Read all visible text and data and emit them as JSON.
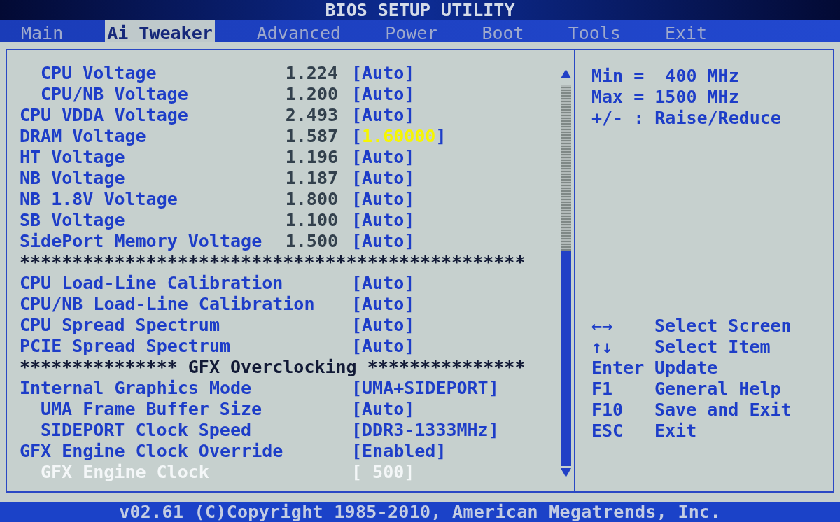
{
  "window": {
    "title": "BIOS SETUP UTILITY"
  },
  "tabs": [
    {
      "label": "Main",
      "selected": false
    },
    {
      "label": "Ai Tweaker",
      "selected": true
    },
    {
      "label": "Advanced",
      "selected": false
    },
    {
      "label": "Power",
      "selected": false
    },
    {
      "label": "Boot",
      "selected": false
    },
    {
      "label": "Tools",
      "selected": false
    },
    {
      "label": "Exit",
      "selected": false
    }
  ],
  "settings": [
    {
      "kind": "group",
      "children": [
        {
          "kind": "option",
          "label": "CPU Voltage",
          "reading": "1.224",
          "setting": "[Auto]",
          "selected": false,
          "modified": false
        },
        {
          "kind": "option",
          "label": "CPU/NB Voltage",
          "reading": "1.200",
          "setting": "[Auto]",
          "selected": false,
          "modified": false
        }
      ]
    },
    {
      "kind": "option",
      "label": "CPU VDDA Voltage",
      "reading": "2.493",
      "setting": "[Auto]",
      "selected": false,
      "modified": false
    },
    {
      "kind": "option",
      "label": "DRAM Voltage",
      "reading": "1.587",
      "setting": "[1.60000]",
      "selected": false,
      "modified": true
    },
    {
      "kind": "option",
      "label": "HT Voltage",
      "reading": "1.196",
      "setting": "[Auto]",
      "selected": false,
      "modified": false
    },
    {
      "kind": "option",
      "label": "NB Voltage",
      "reading": "1.187",
      "setting": "[Auto]",
      "selected": false,
      "modified": false
    },
    {
      "kind": "option",
      "label": "NB 1.8V Voltage",
      "reading": "1.800",
      "setting": "[Auto]",
      "selected": false,
      "modified": false
    },
    {
      "kind": "option",
      "label": "SB Voltage",
      "reading": "1.100",
      "setting": "[Auto]",
      "selected": false,
      "modified": false
    },
    {
      "kind": "option",
      "label": "SidePort Memory Voltage",
      "reading": "1.500",
      "setting": "[Auto]",
      "selected": false,
      "modified": false
    },
    {
      "kind": "separator",
      "text": "************************************************"
    },
    {
      "kind": "option",
      "label": "CPU Load-Line Calibration",
      "setting": "[Auto]",
      "selected": false,
      "modified": false
    },
    {
      "kind": "option",
      "label": "CPU/NB Load-Line Calibration",
      "setting": "[Auto]",
      "selected": false,
      "modified": false
    },
    {
      "kind": "option",
      "label": "CPU Spread Spectrum",
      "setting": "[Auto]",
      "selected": false,
      "modified": false
    },
    {
      "kind": "option",
      "label": "PCIE Spread Spectrum",
      "setting": "[Auto]",
      "selected": false,
      "modified": false
    },
    {
      "kind": "separator",
      "text": "*************** GFX Overclocking ***************"
    },
    {
      "kind": "option",
      "label": "Internal Graphics Mode",
      "setting": "[UMA+SIDEPORT]",
      "selected": false,
      "modified": false,
      "children": [
        {
          "kind": "option",
          "label": "UMA Frame Buffer Size",
          "setting": "[Auto]",
          "selected": false,
          "modified": false
        },
        {
          "kind": "option",
          "label": "SIDEPORT Clock Speed",
          "setting": "[DDR3-1333MHz]",
          "selected": false,
          "modified": false
        }
      ]
    },
    {
      "kind": "option",
      "label": "GFX Engine Clock Override",
      "setting": "[Enabled]",
      "selected": false,
      "modified": false,
      "children": [
        {
          "kind": "option",
          "label": "GFX Engine Clock",
          "setting": "[ 500]",
          "selected": true,
          "modified": false
        }
      ]
    }
  ],
  "help_panel": {
    "lines": [
      "Min =  400 MHz",
      "Max = 1500 MHz",
      "+/- : Raise/Reduce"
    ],
    "keys": [
      {
        "key": "←→",
        "action": "Select Screen"
      },
      {
        "key": "↑↓",
        "action": "Select Item"
      },
      {
        "key": "Enter",
        "action": "Update"
      },
      {
        "key": "F1",
        "action": "General Help"
      },
      {
        "key": "F10",
        "action": "Save and Exit"
      },
      {
        "key": "ESC",
        "action": "Exit"
      }
    ]
  },
  "status_bar": {
    "text": "v02.61 (C)Copyright 1985-2010, American Megatrends, Inc."
  }
}
